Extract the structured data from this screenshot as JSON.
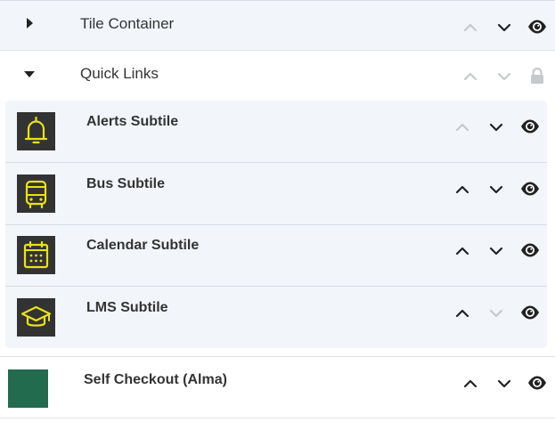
{
  "colors": {
    "row_bg": "#f2f6fb",
    "border": "#dfe4ea",
    "icon_tile_bg": "#333333",
    "icon_yellow": "#e8e21a",
    "self_checkout_swatch": "#236b4e",
    "control_active": "#222222",
    "control_disabled": "#c5c9cd"
  },
  "tile_container": {
    "label": "Tile Container",
    "expand_icon": "caret-right-icon",
    "move_up_enabled": false,
    "move_down_enabled": true,
    "visibility": "eye-icon"
  },
  "quick_links": {
    "label": "Quick Links",
    "expand_icon": "caret-down-icon",
    "move_up_enabled": false,
    "move_down_enabled": false,
    "visibility": "lock-icon",
    "subtiles": [
      {
        "label": "Alerts Subtile",
        "icon": "bell-icon",
        "move_up_enabled": false,
        "move_down_enabled": true,
        "visibility": "eye-icon"
      },
      {
        "label": "Bus Subtile",
        "icon": "bus-icon",
        "move_up_enabled": true,
        "move_down_enabled": true,
        "visibility": "eye-icon"
      },
      {
        "label": "Calendar Subtile",
        "icon": "calendar-icon",
        "move_up_enabled": true,
        "move_down_enabled": true,
        "visibility": "eye-icon"
      },
      {
        "label": "LMS Subtile",
        "icon": "graduation-cap-icon",
        "move_up_enabled": true,
        "move_down_enabled": false,
        "visibility": "eye-icon"
      }
    ]
  },
  "self_checkout": {
    "label": "Self Checkout (Alma)",
    "move_up_enabled": true,
    "move_down_enabled": true,
    "visibility": "eye-icon"
  }
}
